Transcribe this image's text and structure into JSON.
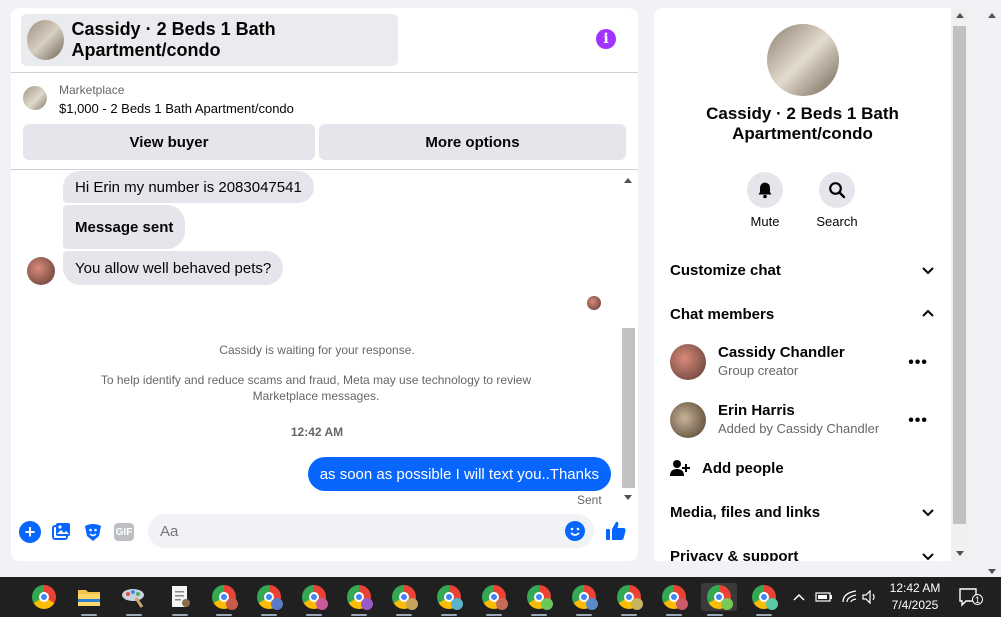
{
  "chat": {
    "header_title": "Cassidy · 2 Beds 1 Bath Apartment/condo",
    "info_icon": "info-icon",
    "marketplace": {
      "label": "Marketplace",
      "listing": "$1,000 - 2 Beds 1 Bath Apartment/condo",
      "view_buyer": "View buyer",
      "more_options": "More options"
    },
    "messages": [
      {
        "text": "Hi Erin my number is 2083047541"
      },
      {
        "text": "Message sent"
      },
      {
        "text": "You allow well behaved pets?"
      }
    ],
    "system_waiting": "Cassidy is waiting for your response.",
    "system_notice": "To help identify and reduce scams and fraud, Meta may use technology to review Marketplace messages.",
    "timestamp": "12:42 AM",
    "outgoing": "as soon as possible I will text you..Thanks",
    "sent_status": "Sent",
    "composer": {
      "placeholder": "Aa",
      "gif_label": "GIF"
    },
    "accent_color": "#0866ff"
  },
  "side": {
    "title": "Cassidy · 2 Beds 1 Bath Apartment/condo",
    "mute_label": "Mute",
    "search_label": "Search",
    "customize_chat": "Customize chat",
    "chat_members": "Chat members",
    "members": [
      {
        "name": "Cassidy Chandler",
        "role": "Group creator"
      },
      {
        "name": "Erin Harris",
        "role": "Added by Cassidy Chandler"
      }
    ],
    "add_people": "Add people",
    "media": "Media, files and links",
    "privacy": "Privacy & support"
  },
  "taskbar": {
    "time": "12:42 AM",
    "date": "7/4/2025",
    "notification_count": "1",
    "icons": [
      "chrome-icon",
      "file-explorer-icon",
      "paint-icon",
      "notepad-icon",
      "chrome-profile-icon"
    ]
  }
}
